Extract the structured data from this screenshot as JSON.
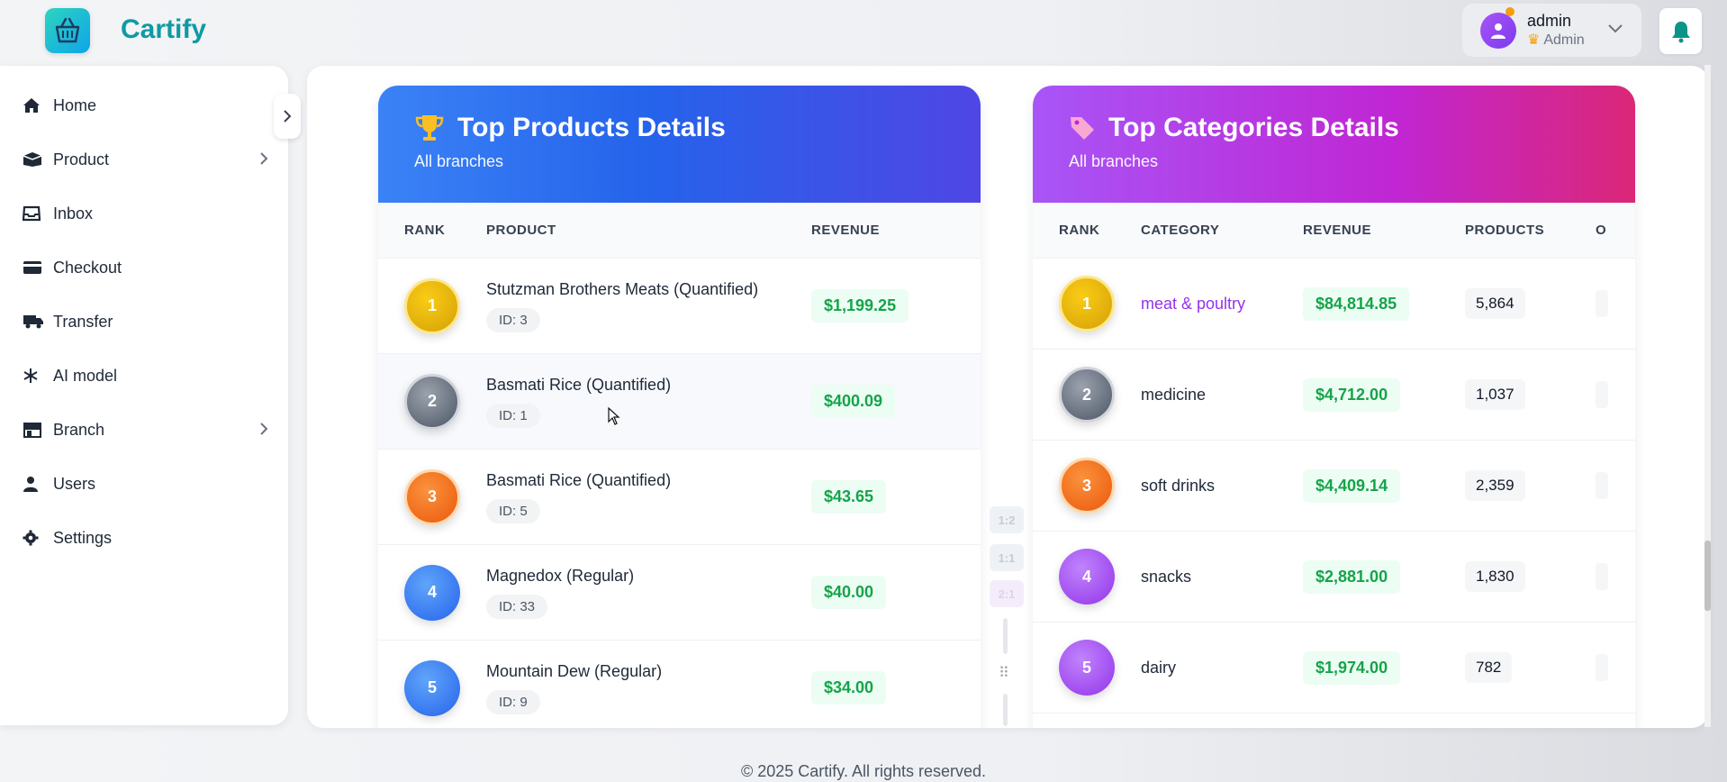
{
  "app": {
    "name": "Cartify",
    "logo_icon": "basket-icon"
  },
  "header": {
    "user": {
      "name": "admin",
      "role": "Admin",
      "status_color": "#f59e0b"
    },
    "notifications_icon": "bell-icon"
  },
  "sidebar": {
    "items": [
      {
        "label": "Home",
        "icon": "home-icon",
        "has_children": false
      },
      {
        "label": "Product",
        "icon": "box-icon",
        "has_children": true
      },
      {
        "label": "Inbox",
        "icon": "inbox-icon",
        "has_children": false
      },
      {
        "label": "Checkout",
        "icon": "credit-card-icon",
        "has_children": false
      },
      {
        "label": "Transfer",
        "icon": "truck-icon",
        "has_children": false
      },
      {
        "label": "AI model",
        "icon": "ai-model-icon",
        "has_children": false
      },
      {
        "label": "Branch",
        "icon": "store-icon",
        "has_children": true
      },
      {
        "label": "Users",
        "icon": "user-icon",
        "has_children": false
      },
      {
        "label": "Settings",
        "icon": "gear-icon",
        "has_children": false
      }
    ]
  },
  "top_products": {
    "title": "Top Products Details",
    "subtitle": "All branches",
    "columns": [
      "RANK",
      "PRODUCT",
      "REVENUE"
    ],
    "rows": [
      {
        "rank": "1",
        "product": "Stutzman Brothers Meats (Quantified)",
        "id": "ID: 3",
        "revenue": "$1,199.25"
      },
      {
        "rank": "2",
        "product": "Basmati Rice (Quantified)",
        "id": "ID: 1",
        "revenue": "$400.09"
      },
      {
        "rank": "3",
        "product": "Basmati Rice (Quantified)",
        "id": "ID: 5",
        "revenue": "$43.65"
      },
      {
        "rank": "4",
        "product": "Magnedox (Regular)",
        "id": "ID: 33",
        "revenue": "$40.00"
      },
      {
        "rank": "5",
        "product": "Mountain Dew (Regular)",
        "id": "ID: 9",
        "revenue": "$34.00"
      }
    ]
  },
  "top_categories": {
    "title": "Top Categories Details",
    "subtitle": "All branches",
    "columns": [
      "RANK",
      "CATEGORY",
      "REVENUE",
      "PRODUCTS",
      "O"
    ],
    "rows": [
      {
        "rank": "1",
        "category": "meat & poultry",
        "revenue": "$84,814.85",
        "products": "5,864"
      },
      {
        "rank": "2",
        "category": "medicine",
        "revenue": "$4,712.00",
        "products": "1,037"
      },
      {
        "rank": "3",
        "category": "soft drinks",
        "revenue": "$4,409.14",
        "products": "2,359"
      },
      {
        "rank": "4",
        "category": "snacks",
        "revenue": "$2,881.00",
        "products": "1,830"
      },
      {
        "rank": "5",
        "category": "dairy",
        "revenue": "$1,974.00",
        "products": "782"
      }
    ]
  },
  "layout_controls": {
    "ratios": [
      "1:2",
      "1:1",
      "2:1"
    ]
  },
  "footer": {
    "text": "© 2025 Cartify. All rights reserved."
  },
  "colors": {
    "brand": "#0f9aa3",
    "revenue": "#16a34a",
    "products_header": "#2563eb",
    "categories_header": "#c026d3"
  }
}
